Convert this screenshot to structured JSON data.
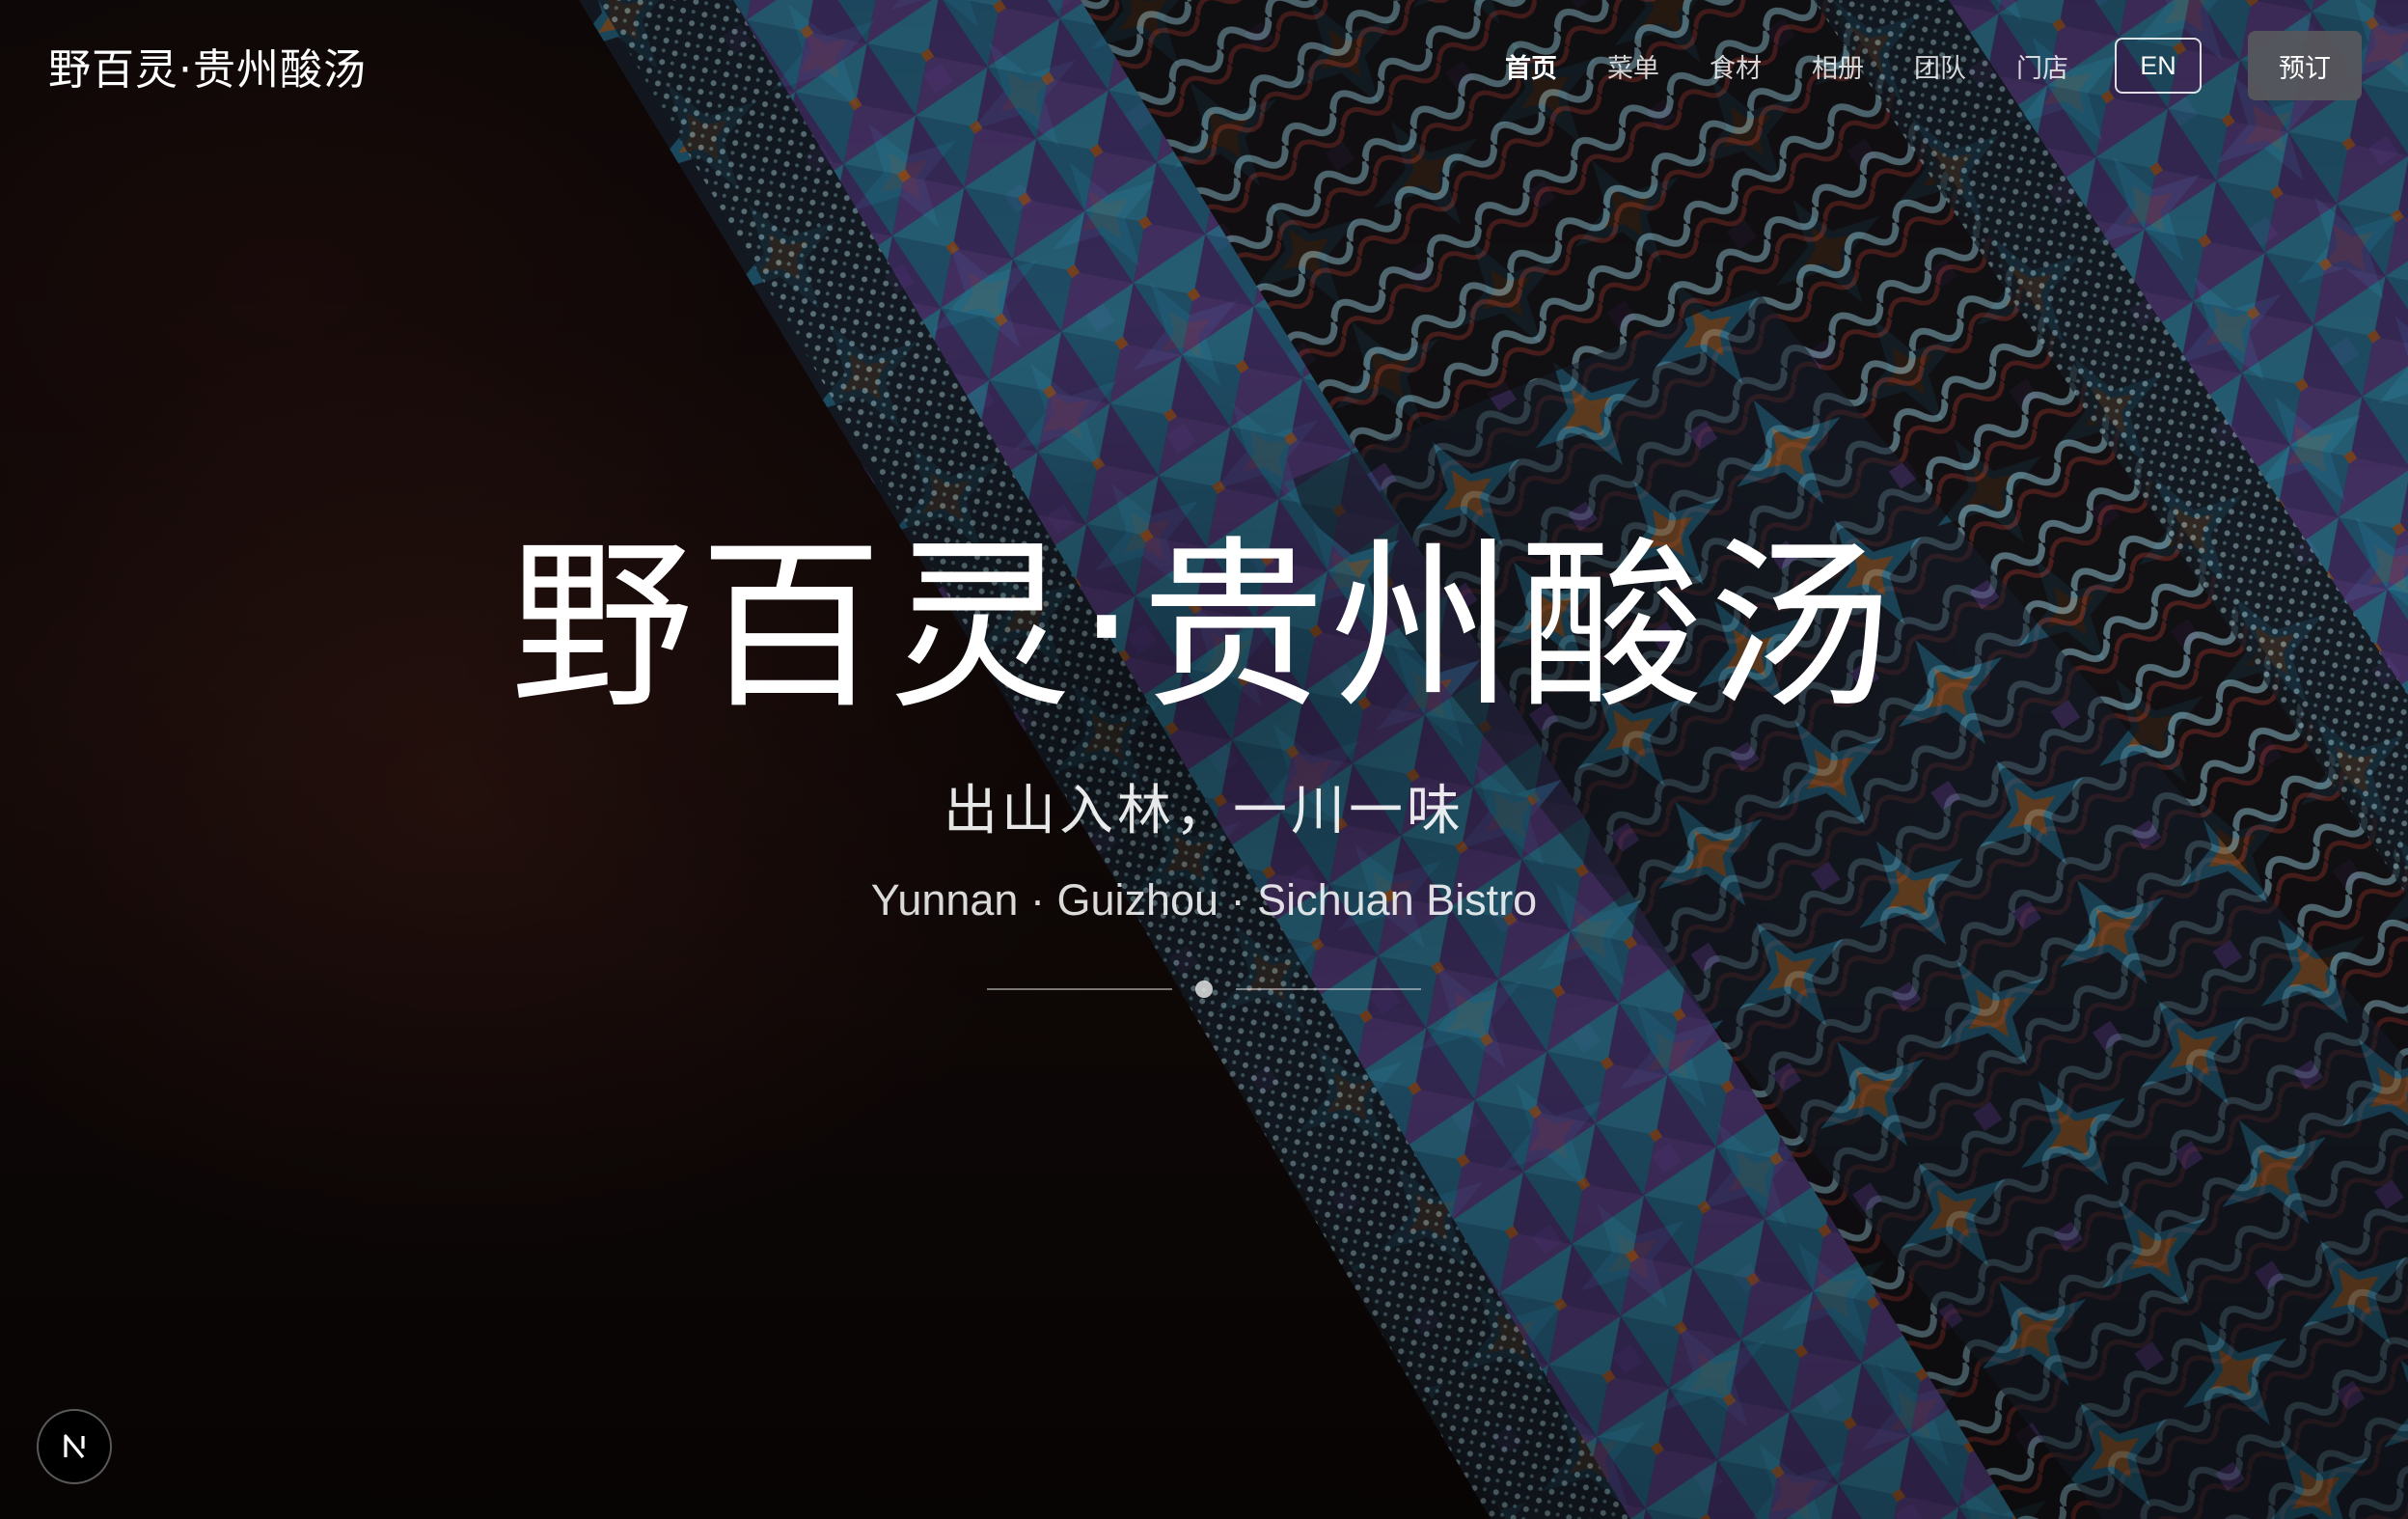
{
  "header": {
    "brand": "野百灵·贵州酸汤",
    "nav": [
      {
        "label": "首页",
        "active": true
      },
      {
        "label": "菜单",
        "active": false
      },
      {
        "label": "食材",
        "active": false
      },
      {
        "label": "相册",
        "active": false
      },
      {
        "label": "团队",
        "active": false
      },
      {
        "label": "门店",
        "active": false
      }
    ],
    "language_label": "EN",
    "reserve_label": "预订"
  },
  "hero": {
    "title": "野百灵·贵州酸汤",
    "subtitle": "出山入林，一川一味",
    "tagline": "Yunnan · Guizhou · Sichuan Bistro",
    "carousel_active_index": 0
  },
  "badge": {
    "icon": "n-logo-icon"
  },
  "colors": {
    "background": "#0b0706",
    "text": "#ffffff",
    "reserve_button_bg": "#58585c"
  }
}
